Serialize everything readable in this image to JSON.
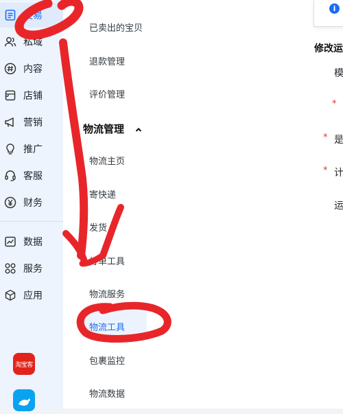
{
  "sidebar": {
    "items": [
      {
        "label": "交易",
        "icon": "document-icon",
        "active": true
      },
      {
        "label": "私域",
        "icon": "users-icon"
      },
      {
        "label": "内容",
        "icon": "hash-icon"
      },
      {
        "label": "店铺",
        "icon": "shop-icon"
      },
      {
        "label": "营销",
        "icon": "megaphone-icon"
      },
      {
        "label": "推广",
        "icon": "lightbulb-icon"
      },
      {
        "label": "客服",
        "icon": "headset-icon"
      },
      {
        "label": "财务",
        "icon": "yuan-icon"
      },
      {
        "label": "数据",
        "icon": "chart-icon"
      },
      {
        "label": "服务",
        "icon": "grid-icon"
      },
      {
        "label": "应用",
        "icon": "cube-icon"
      }
    ],
    "apps": {
      "taoke_label": "淘宝客"
    }
  },
  "menu": {
    "items_top": [
      "已卖出的宝贝",
      "退款管理",
      "评价管理"
    ],
    "group_label": "物流管理",
    "group_items": [
      "物流主页",
      "寄快递",
      "发货",
      "打单工具",
      "物流服务",
      "物流工具",
      "包裹监控",
      "物流数据"
    ],
    "active_item": "物流工具"
  },
  "content": {
    "title": "修改运",
    "labels": [
      "模",
      "是",
      "计",
      "运"
    ],
    "required_marker": "*"
  },
  "colors": {
    "accent": "#1b6df0",
    "annotation": "#e8262a",
    "required": "#e0352b"
  }
}
